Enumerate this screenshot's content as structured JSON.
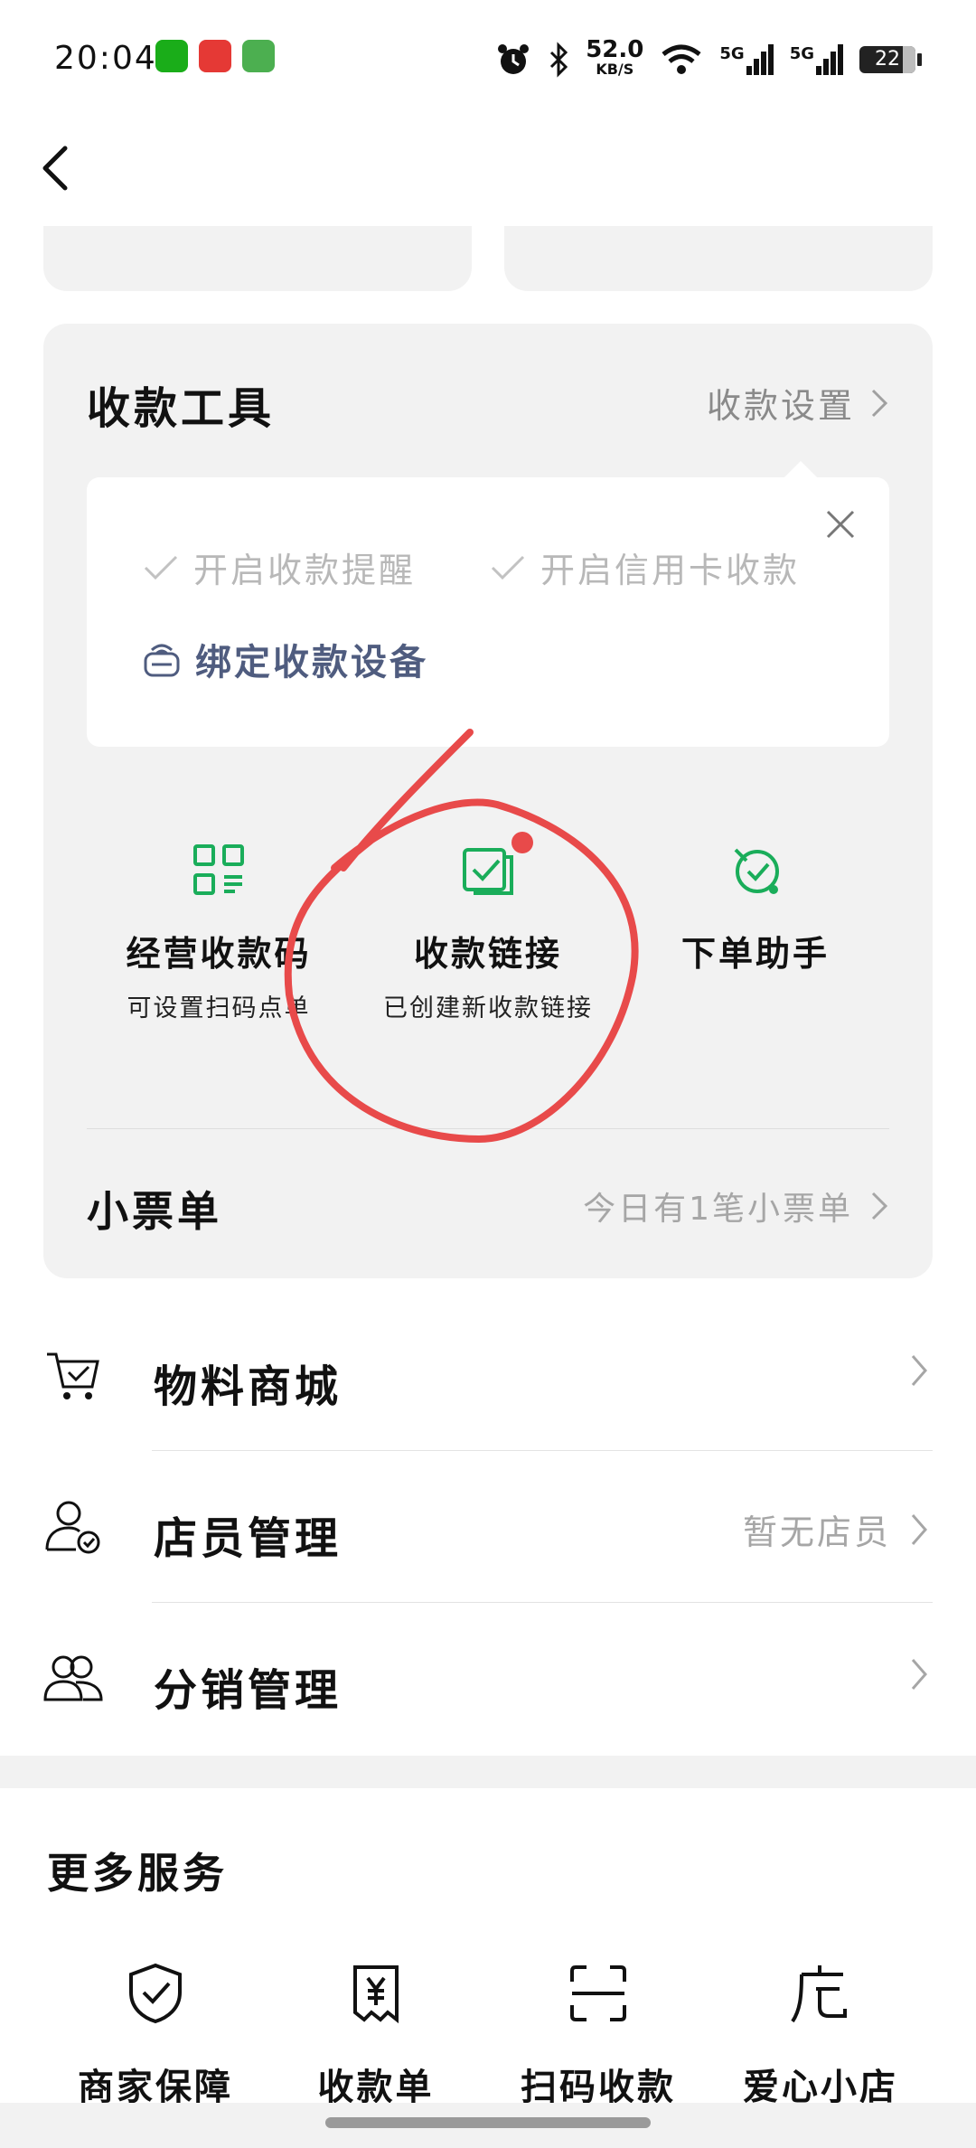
{
  "status_bar": {
    "time": "20:04",
    "net_speed": "52.0",
    "net_unit": "KB/S",
    "sim1": "5G",
    "sim2": "5G",
    "battery": "22",
    "battery_level": 0.22
  },
  "tools": {
    "title": "收款工具",
    "settings_label": "收款设置",
    "popup": {
      "option_reminder": "开启收款提醒",
      "option_credit": "开启信用卡收款",
      "bind_device": "绑定收款设备"
    },
    "items": [
      {
        "name": "经营收款码",
        "sub": "可设置扫码点单"
      },
      {
        "name": "收款链接",
        "sub": "已创建新收款链接"
      },
      {
        "name": "下单助手",
        "sub": ""
      }
    ],
    "receipt": {
      "title": "小票单",
      "note": "今日有1笔小票单"
    }
  },
  "list": [
    {
      "label": "物料商城",
      "right": ""
    },
    {
      "label": "店员管理",
      "right": "暂无店员"
    },
    {
      "label": "分销管理",
      "right": ""
    }
  ],
  "more_services": {
    "title": "更多服务",
    "items": [
      {
        "label": "商家保障",
        "icon": "shield-check-icon"
      },
      {
        "label": "收款单",
        "icon": "yuan-receipt-icon"
      },
      {
        "label": "扫码收款",
        "icon": "scan-icon"
      },
      {
        "label": "爱心小店",
        "icon": "store-icon"
      }
    ]
  },
  "colors": {
    "accent_green": "#1aad5a",
    "annotation_red": "#e84a4a",
    "device_blue": "#4f5c7f"
  }
}
